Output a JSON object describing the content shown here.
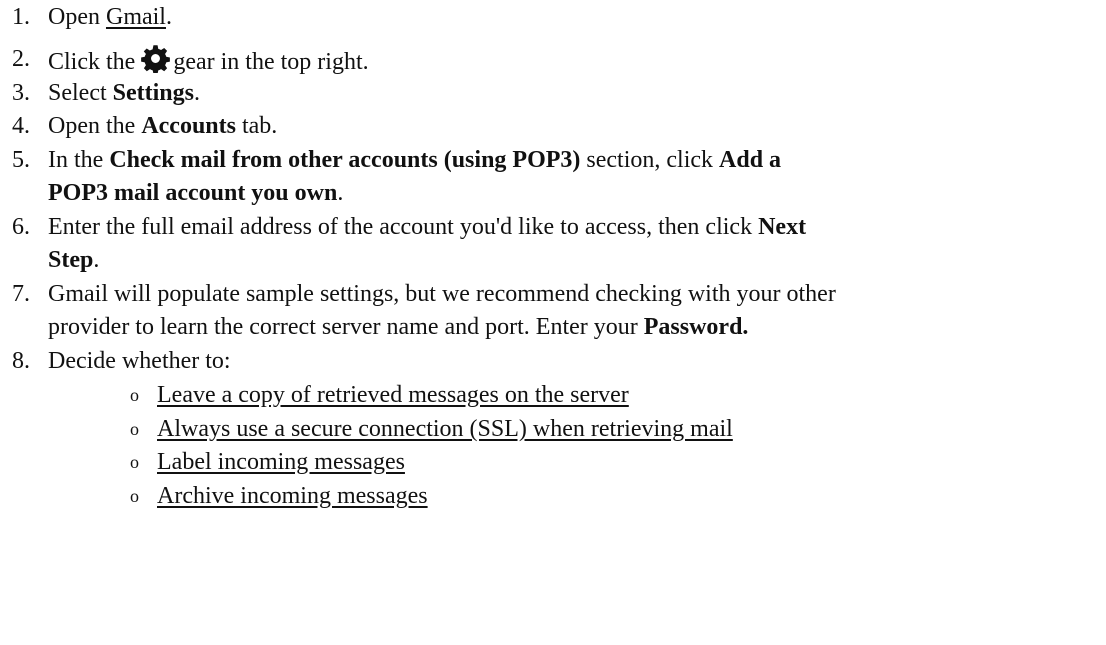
{
  "steps": [
    {
      "num": "1.",
      "pre": "Open ",
      "link": "Gmail",
      "post": "."
    },
    {
      "num": "2.",
      "pre": "Click the",
      "icon": "gear-icon",
      "post": "gear in the top right."
    },
    {
      "num": "3.",
      "pre": "Select ",
      "bold": "Settings",
      "post": "."
    },
    {
      "num": "4.",
      "pre": "Open the ",
      "bold": "Accounts",
      "post": " tab."
    },
    {
      "num": "5.",
      "pre": "In the ",
      "bold1": "Check mail from other accounts (using POP3)",
      "mid": " section, click ",
      "bold2a": "Add a",
      "bold2b": "POP3 mail account you own",
      "post": "."
    },
    {
      "num": "6.",
      "pre": "Enter the full email address of the account you'd like to access, then click ",
      "bold_a": "Next",
      "bold_b": "Step",
      "post": "."
    },
    {
      "num": "7.",
      "line1": "Gmail will populate sample settings, but we recommend checking with your other",
      "pre2": "provider to learn the correct server name and port. Enter your ",
      "bold": "Password.",
      "post": ""
    },
    {
      "num": "8.",
      "text": "Decide whether to:"
    }
  ],
  "bullet_glyph": "o",
  "options": [
    "Leave a copy of retrieved messages on the server",
    "Always use a secure connection (SSL) when retrieving mail",
    "Label incoming messages",
    "Archive incoming messages"
  ]
}
